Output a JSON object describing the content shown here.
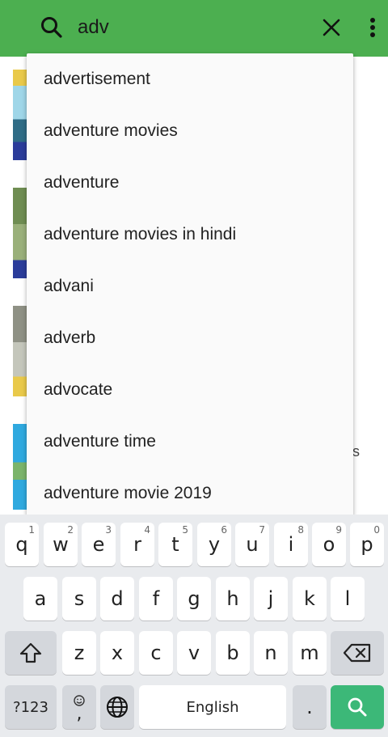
{
  "search": {
    "query": "adv"
  },
  "suggestions": [
    "advertisement",
    "adventure movies",
    "adventure",
    "adventure movies in hindi",
    "advani",
    "adverb",
    "advocate",
    "adventure time",
    "adventure movie 2019"
  ],
  "background": {
    "partial_text": "s"
  },
  "keyboard": {
    "row1": [
      {
        "key": "q",
        "hint": "1"
      },
      {
        "key": "w",
        "hint": "2"
      },
      {
        "key": "e",
        "hint": "3"
      },
      {
        "key": "r",
        "hint": "4"
      },
      {
        "key": "t",
        "hint": "5"
      },
      {
        "key": "y",
        "hint": "6"
      },
      {
        "key": "u",
        "hint": "7"
      },
      {
        "key": "i",
        "hint": "8"
      },
      {
        "key": "o",
        "hint": "9"
      },
      {
        "key": "p",
        "hint": "0"
      }
    ],
    "row2": [
      "a",
      "s",
      "d",
      "f",
      "g",
      "h",
      "j",
      "k",
      "l"
    ],
    "row3": [
      "z",
      "x",
      "c",
      "v",
      "b",
      "n",
      "m"
    ],
    "symbols_label": "?123",
    "comma_label": ",",
    "space_label": "English",
    "period_label": "."
  },
  "colors": {
    "toolbar": "#4caf50",
    "search_key": "#3cb878",
    "keyboard_bg": "#e9ebee"
  },
  "icons": {
    "toolbar": [
      "search-icon",
      "close-icon",
      "more-vert-icon"
    ],
    "keyboard": [
      "shift-icon",
      "backspace-icon",
      "emoji-icon",
      "globe-icon",
      "search-icon"
    ]
  }
}
